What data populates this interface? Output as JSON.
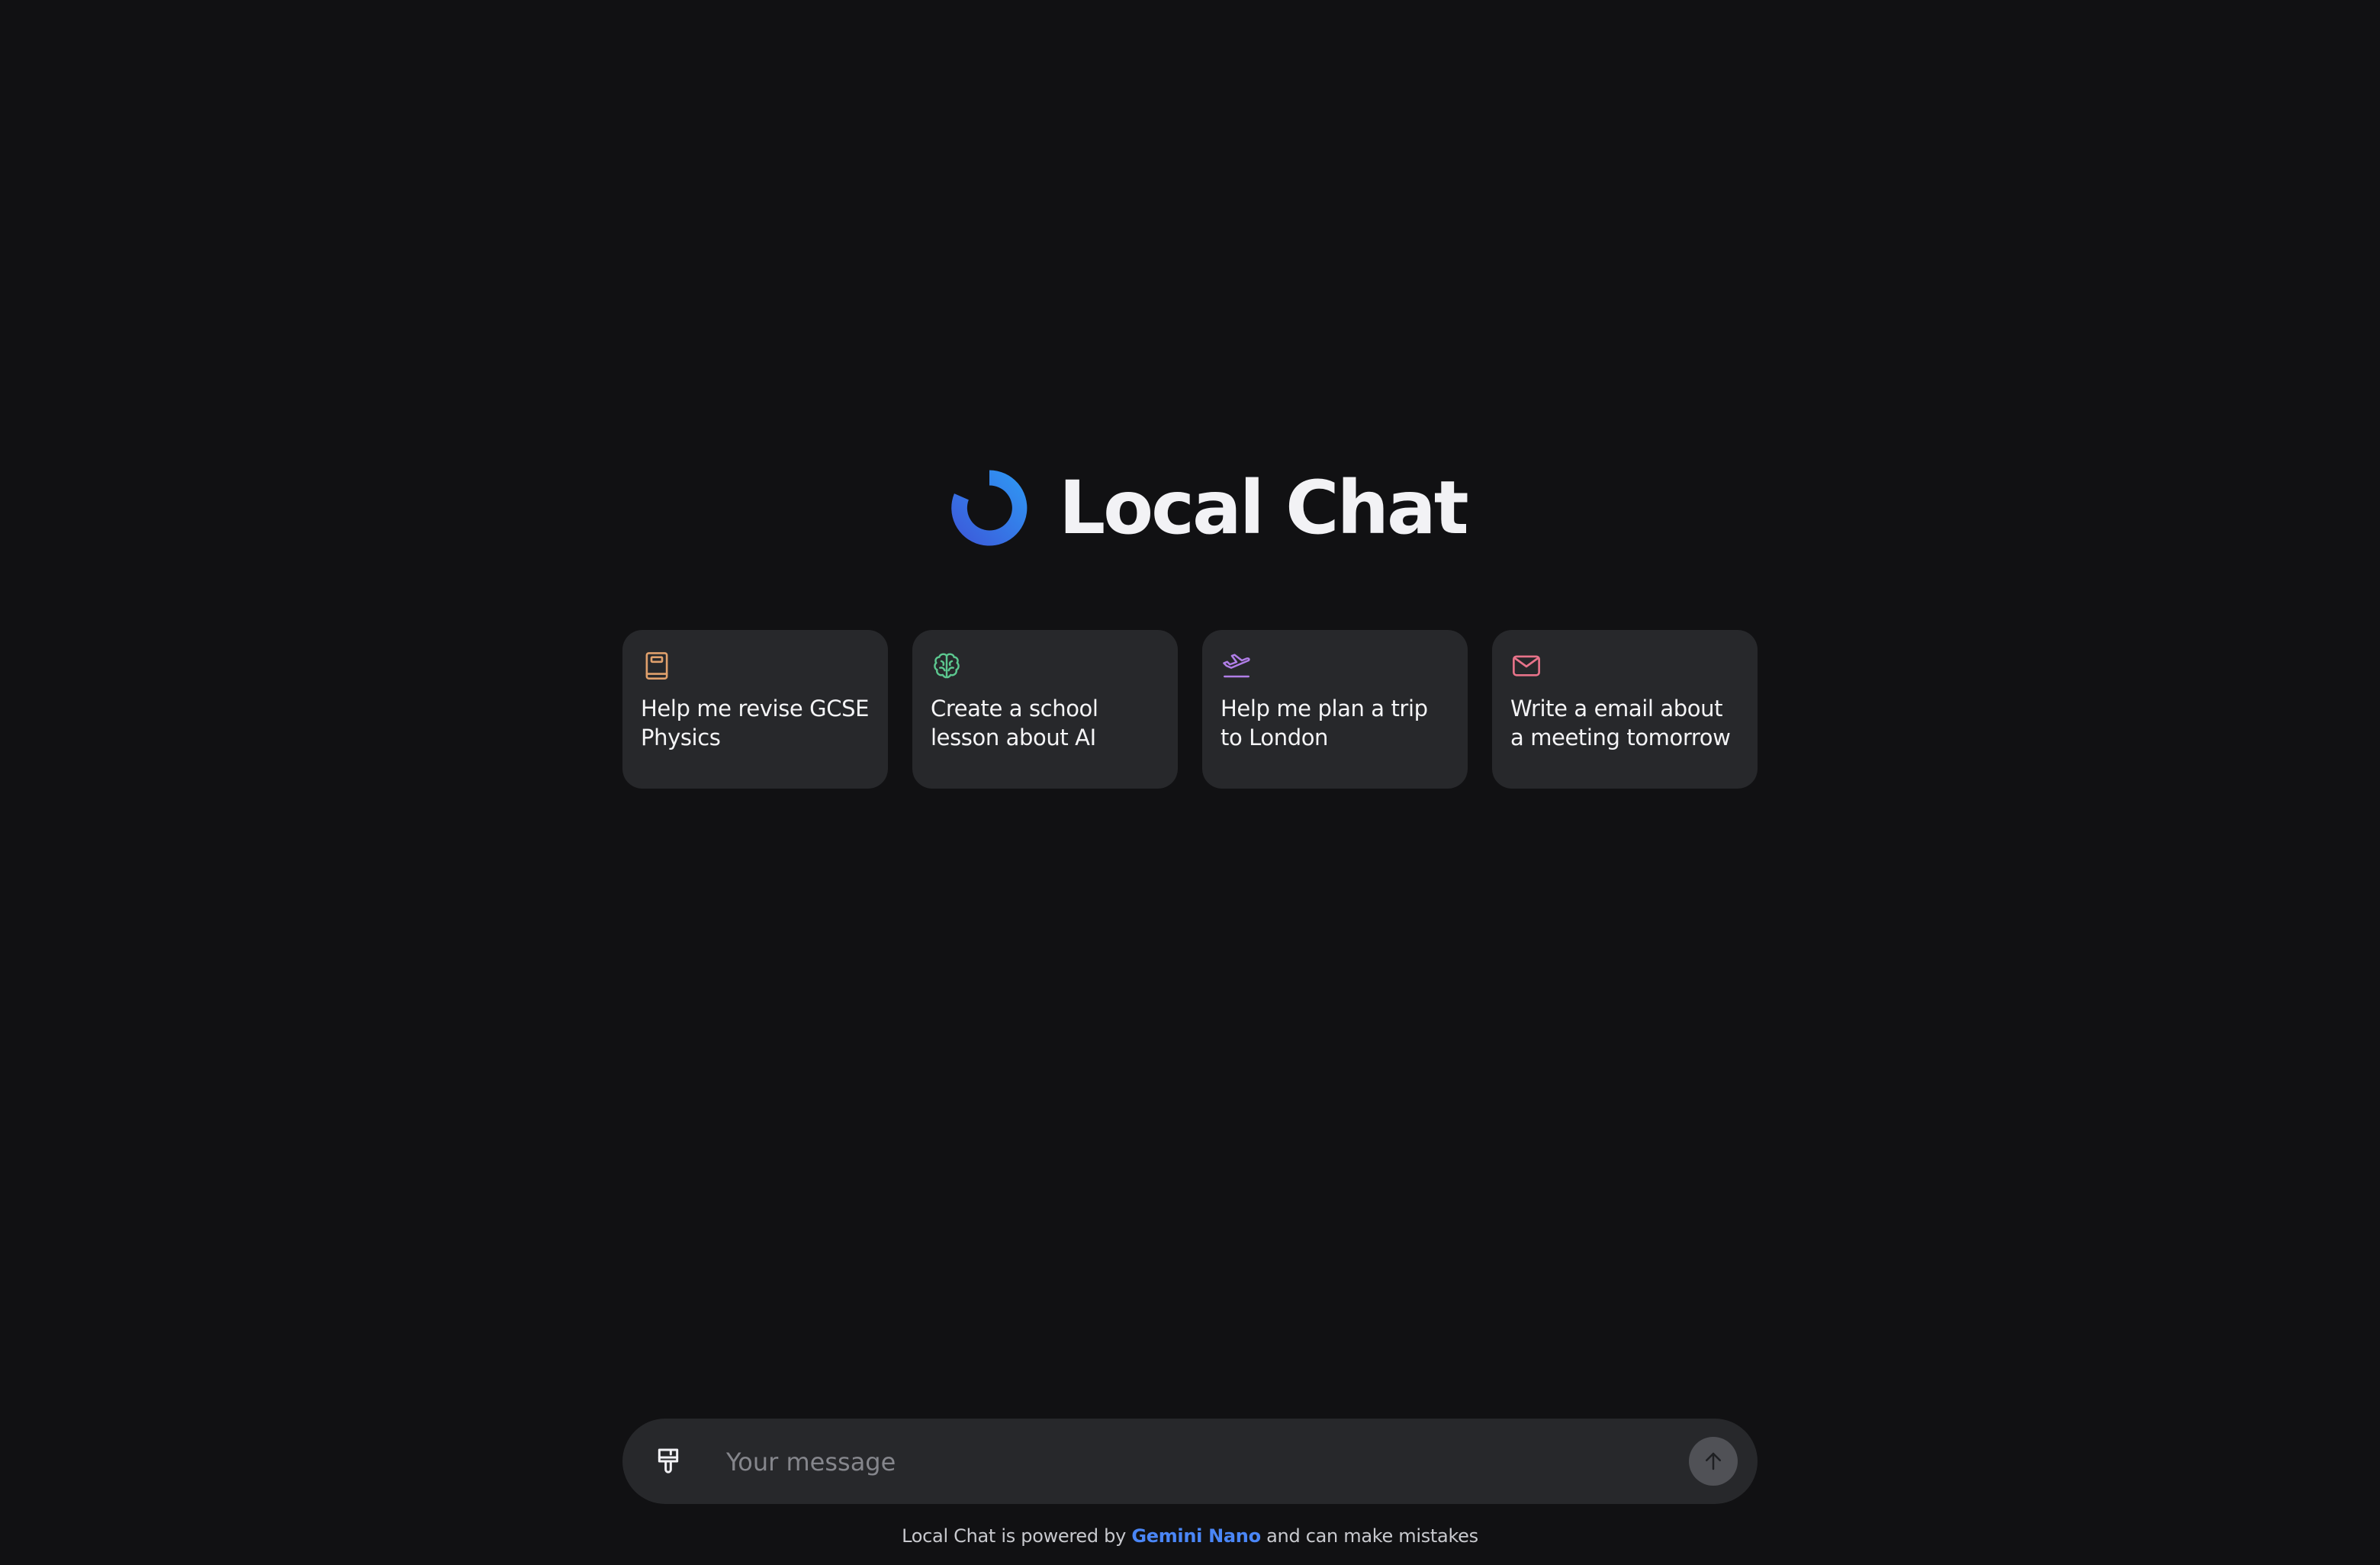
{
  "app": {
    "title": "Local Chat"
  },
  "suggestions": [
    {
      "icon": "book-icon",
      "label": "Help me revise GCSE Physics",
      "icon_color": "#e0a06c"
    },
    {
      "icon": "brain-icon",
      "label": "Create a school lesson about AI",
      "icon_color": "#5cc78f"
    },
    {
      "icon": "plane-departure-icon",
      "label": "Help me plan a trip to London",
      "icon_color": "#b17ee8"
    },
    {
      "icon": "mail-icon",
      "label": "Write a email about a meeting tomorrow",
      "icon_color": "#e8738a"
    }
  ],
  "composer": {
    "placeholder": "Your message",
    "value": "",
    "left_icon": "paintbrush-icon",
    "send_icon": "arrow-up-icon"
  },
  "footer": {
    "prefix": "Local Chat is powered by",
    "model": "Gemini Nano",
    "suffix": "and can make mistakes"
  },
  "colors": {
    "background": "#111113",
    "card": "#27282b",
    "accent": "#4a86f7",
    "logo_gradient_start": "#2e9bf5",
    "logo_gradient_end": "#3d55d8"
  }
}
